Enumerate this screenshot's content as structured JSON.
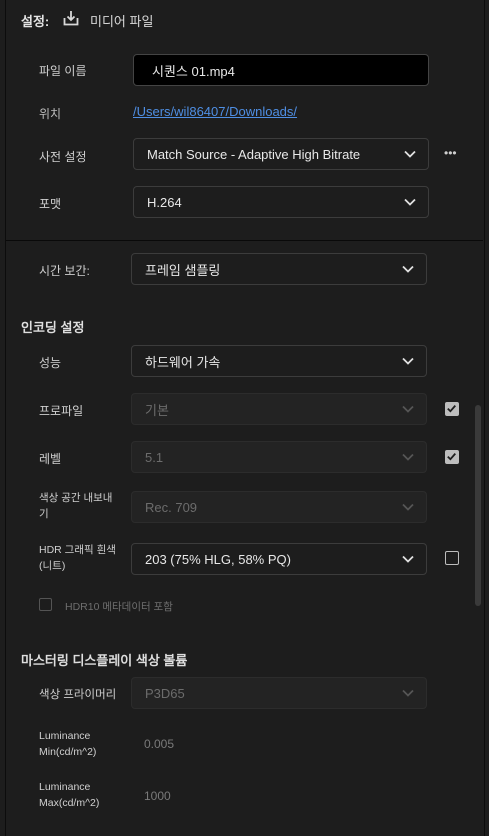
{
  "header": {
    "title": "설정:",
    "media_label": "미디어 파일",
    "media_icon": "export-icon"
  },
  "file": {
    "name_label": "파일 이름",
    "name_value": "시퀀스 01.mp4",
    "location_label": "위치",
    "location_value": "/Users/wil86407/Downloads/",
    "preset_label": "사전 설정",
    "preset_value": "Match Source - Adaptive High Bitrate",
    "preset_more": "•••",
    "format_label": "포맷",
    "format_value": "H.264"
  },
  "time": {
    "label": "시간 보간:",
    "value": "프레임 샘플링"
  },
  "encoding": {
    "title": "인코딩 설정",
    "performance_label": "성능",
    "performance_value": "하드웨어 가속",
    "profile_label": "프로파일",
    "profile_value": "기본",
    "profile_checked": true,
    "level_label": "레벨",
    "level_value": "5.1",
    "level_checked": true,
    "colorspace_label": "색상 공간 내보내기",
    "colorspace_value": "Rec. 709",
    "hdr_label": "HDR 그래픽 흰색 (니트)",
    "hdr_value": "203 (75% HLG, 58% PQ)",
    "hdr_checked": false,
    "hdr10_label": "HDR10 메타데이터 포함",
    "hdr10_checked": false
  },
  "mastering": {
    "title": "마스터링 디스플레이 색상 볼륨",
    "primaries_label": "색상 프라이머리",
    "primaries_value": "P3D65",
    "lum_min_label": "Luminance Min(cd/m^2)",
    "lum_min_value": "0.005",
    "lum_max_label": "Luminance Max(cd/m^2)",
    "lum_max_value": "1000"
  },
  "colors": {
    "accent_link": "#4f8fe4",
    "background": "#1d1d1d"
  }
}
